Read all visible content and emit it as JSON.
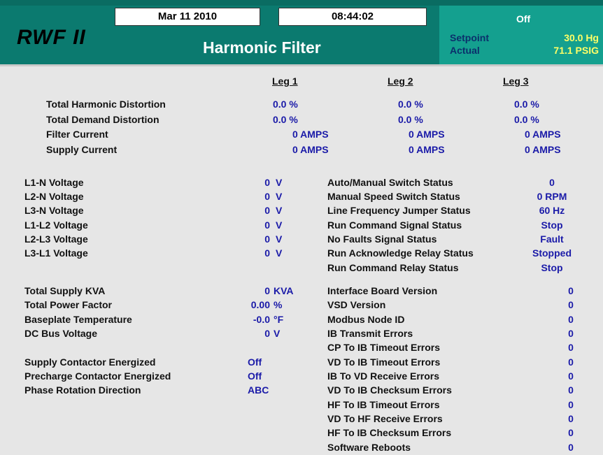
{
  "header": {
    "date": "Mar 11 2010",
    "time": "08:44:02",
    "logo": "RWF II",
    "title": "Harmonic Filter",
    "status": "Off",
    "setpoint_label": "Setpoint",
    "setpoint_value": "30.0 Hg",
    "actual_label": "Actual",
    "actual_value": "71.1 PSIG"
  },
  "legs": {
    "headers": [
      "Leg 1",
      "Leg 2",
      "Leg 3"
    ],
    "rows": [
      {
        "label": "Total Harmonic Distortion",
        "values": [
          "0.0 %",
          "0.0 %",
          "0.0 %"
        ]
      },
      {
        "label": "Total Demand Distortion",
        "values": [
          "0.0 %",
          "0.0 %",
          "0.0 %"
        ]
      },
      {
        "label": "Filter Current",
        "values": [
          "0 AMPS",
          "0 AMPS",
          "0 AMPS"
        ]
      },
      {
        "label": "Supply Current",
        "values": [
          "0 AMPS",
          "0 AMPS",
          "0 AMPS"
        ]
      }
    ]
  },
  "voltages": [
    {
      "label": "L1-N Voltage",
      "value": "0",
      "unit": "V"
    },
    {
      "label": "L2-N Voltage",
      "value": "0",
      "unit": "V"
    },
    {
      "label": "L3-N Voltage",
      "value": "0",
      "unit": "V"
    },
    {
      "label": "L1-L2 Voltage",
      "value": "0",
      "unit": "V"
    },
    {
      "label": "L2-L3 Voltage",
      "value": "0",
      "unit": "V"
    },
    {
      "label": "L3-L1 Voltage",
      "value": "0",
      "unit": "V"
    }
  ],
  "power": [
    {
      "label": "Total Supply KVA",
      "value": "0",
      "unit": "KVA"
    },
    {
      "label": "Total Power Factor",
      "value": "0.00",
      "unit": "%"
    },
    {
      "label": "Baseplate Temperature",
      "value": "-0.0",
      "unit": "°F"
    },
    {
      "label": "DC Bus Voltage",
      "value": "0",
      "unit": "V"
    }
  ],
  "contactors": [
    {
      "label": "Supply Contactor Energized",
      "value": "Off"
    },
    {
      "label": "Precharge Contactor Energized",
      "value": "Off"
    },
    {
      "label": "Phase Rotation Direction",
      "value": "ABC"
    }
  ],
  "status_group": [
    {
      "label": "Auto/Manual Switch Status",
      "value": "0"
    },
    {
      "label": "Manual Speed Switch Status",
      "value": "0 RPM"
    },
    {
      "label": "Line Frequency Jumper Status",
      "value": "60 Hz"
    },
    {
      "label": "Run Command Signal Status",
      "value": "Stop"
    },
    {
      "label": "No Faults Signal Status",
      "value": "Fault"
    },
    {
      "label": "Run Acknowledge Relay Status",
      "value": "Stopped"
    },
    {
      "label": "Run Command Relay Status",
      "value": "Stop"
    }
  ],
  "board_group": [
    {
      "label": "Interface Board Version",
      "value": "0"
    },
    {
      "label": "VSD Version",
      "value": "0"
    },
    {
      "label": "Modbus Node ID",
      "value": "0"
    },
    {
      "label": "IB Transmit Errors",
      "value": "0"
    },
    {
      "label": "CP To IB Timeout Errors",
      "value": "0"
    },
    {
      "label": "VD To IB Timeout Errors",
      "value": "0"
    },
    {
      "label": "IB To VD Receive Errors",
      "value": "0"
    },
    {
      "label": "VD To IB Checksum Errors",
      "value": "0"
    },
    {
      "label": "HF To IB Timeout Errors",
      "value": "0"
    },
    {
      "label": "VD To HF Receive Errors",
      "value": "0"
    },
    {
      "label": "HF To IB Checksum Errors",
      "value": "0"
    },
    {
      "label": "Software Reboots",
      "value": "0"
    }
  ]
}
